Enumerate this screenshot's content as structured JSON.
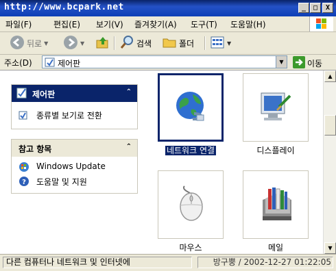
{
  "window": {
    "title": "http://www.bcpark.net",
    "minimize": "_",
    "maximize": "□",
    "close": "X"
  },
  "menubar": {
    "items": [
      "파일(F)",
      "편집(E)",
      "보기(V)",
      "즐겨찾기(A)",
      "도구(T)",
      "도움말(H)"
    ]
  },
  "toolbar": {
    "back": "뒤로",
    "search": "검색",
    "folders": "폴더"
  },
  "address": {
    "label": "주소(D)",
    "value": "제어판",
    "go": "이동"
  },
  "sidebar": {
    "control_panel": {
      "title": "제어판",
      "link": "종류별 보기로 전환"
    },
    "see_also": {
      "title": "참고 항목",
      "links": [
        "Windows Update",
        "도움말 및 지원"
      ]
    }
  },
  "items": [
    {
      "label": "네트워크 연결",
      "icon": "network-globe-icon",
      "selected": true
    },
    {
      "label": "디스플레이",
      "icon": "display-icon",
      "selected": false
    },
    {
      "label": "마우스",
      "icon": "mouse-icon",
      "selected": false
    },
    {
      "label": "메일",
      "icon": "mail-icon",
      "selected": false
    }
  ],
  "status": {
    "left": "다른 컴퓨터나 네트워크 및 인터넷에",
    "right": "방구뿡 / 2002-12-27 01:22:05"
  },
  "colors": {
    "titlebar": "#0a246a",
    "panel_header": "#0a246a",
    "selection": "#0a246a"
  }
}
